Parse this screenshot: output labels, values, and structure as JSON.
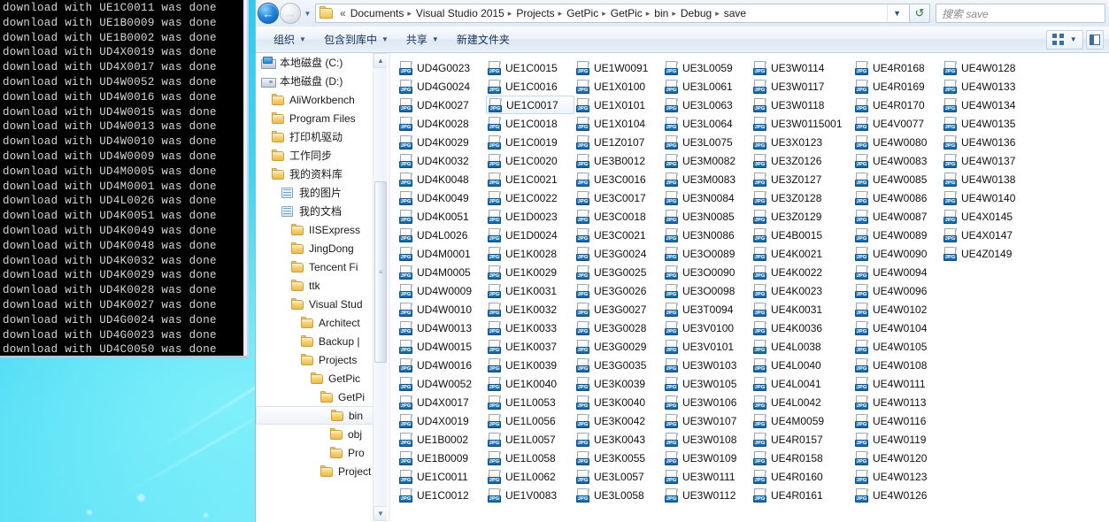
{
  "console": {
    "lines": [
      "download with UE1C0011 was done",
      "download with UE1B0009 was done",
      "download with UE1B0002 was done",
      "download with UD4X0019 was done",
      "download with UD4X0017 was done",
      "download with UD4W0052 was done",
      "download with UD4W0016 was done",
      "download with UD4W0015 was done",
      "download with UD4W0013 was done",
      "download with UD4W0010 was done",
      "download with UD4W0009 was done",
      "download with UD4M0005 was done",
      "download with UD4M0001 was done",
      "download with UD4L0026 was done",
      "download with UD4K0051 was done",
      "download with UD4K0049 was done",
      "download with UD4K0048 was done",
      "download with UD4K0032 was done",
      "download with UD4K0029 was done",
      "download with UD4K0028 was done",
      "download with UD4K0027 was done",
      "download with UD4G0024 was done",
      "download with UD4G0023 was done",
      "download with UD4C0050 was done"
    ]
  },
  "explorer": {
    "addressbar": {
      "back_glyph": "←",
      "forward_glyph": "→",
      "history_glyph": "▼",
      "overflow_glyph": "«",
      "dropdown_glyph": "▼",
      "refresh_glyph": "↺",
      "crumbs": [
        "Documents",
        "Visual Studio 2015",
        "Projects",
        "GetPic",
        "GetPic",
        "bin",
        "Debug",
        "save"
      ],
      "separator": "▸"
    },
    "search": {
      "placeholder": "搜索 save",
      "value": ""
    },
    "toolbar": {
      "items": [
        {
          "label": "组织",
          "has_caret": true
        },
        {
          "label": "包含到库中",
          "has_caret": true
        },
        {
          "label": "共享",
          "has_caret": true
        },
        {
          "label": "新建文件夹",
          "has_caret": false
        }
      ],
      "view_caret": "▼"
    },
    "nav_tree": {
      "scroll_up_glyph": "▲",
      "scroll_down_glyph": "▼",
      "thumb_grip": "≡",
      "items": [
        {
          "label": "本地磁盘 (C:)",
          "icon": "drive-c-icon",
          "indent": 0,
          "selected": false
        },
        {
          "label": "本地磁盘 (D:)",
          "icon": "drive-d-icon",
          "indent": 0,
          "selected": false
        },
        {
          "label": "AliWorkbench",
          "icon": "folder-icon",
          "indent": 1,
          "selected": false
        },
        {
          "label": "Program Files",
          "icon": "folder-icon",
          "indent": 1,
          "selected": false
        },
        {
          "label": "打印机驱动",
          "icon": "folder-icon",
          "indent": 1,
          "selected": false
        },
        {
          "label": "工作同步",
          "icon": "folder-icon",
          "indent": 1,
          "selected": false
        },
        {
          "label": "我的资料库",
          "icon": "folder-icon",
          "indent": 1,
          "selected": false
        },
        {
          "label": "我的图片",
          "icon": "library-icon",
          "indent": 2,
          "selected": false
        },
        {
          "label": "我的文档",
          "icon": "library-icon",
          "indent": 2,
          "selected": false
        },
        {
          "label": "IISExpress",
          "icon": "folder-icon",
          "indent": 3,
          "selected": false
        },
        {
          "label": "JingDong",
          "icon": "folder-icon",
          "indent": 3,
          "selected": false
        },
        {
          "label": "Tencent Fi",
          "icon": "folder-icon",
          "indent": 3,
          "selected": false
        },
        {
          "label": "ttk",
          "icon": "folder-icon",
          "indent": 3,
          "selected": false
        },
        {
          "label": "Visual Stud",
          "icon": "folder-icon",
          "indent": 3,
          "selected": false
        },
        {
          "label": "Architect",
          "icon": "folder-icon",
          "indent": 4,
          "selected": false
        },
        {
          "label": "Backup |",
          "icon": "folder-icon",
          "indent": 4,
          "selected": false
        },
        {
          "label": "Projects",
          "icon": "folder-icon",
          "indent": 4,
          "selected": false
        },
        {
          "label": "GetPic",
          "icon": "folder-icon",
          "indent": 5,
          "selected": false
        },
        {
          "label": "GetPi",
          "icon": "folder-icon",
          "indent": 6,
          "selected": false
        },
        {
          "label": "bin",
          "icon": "folder-icon",
          "indent": 7,
          "selected": true
        },
        {
          "label": "obj",
          "icon": "folder-icon",
          "indent": 7,
          "selected": false
        },
        {
          "label": "Pro",
          "icon": "folder-icon",
          "indent": 7,
          "selected": false
        },
        {
          "label": "Project",
          "icon": "folder-icon",
          "indent": 6,
          "selected": false
        }
      ]
    },
    "files": {
      "icon_label": "JPG",
      "selected": "UE1C0017",
      "names": [
        "UD4G0023",
        "UD4G0024",
        "UD4K0027",
        "UD4K0028",
        "UD4K0029",
        "UD4K0032",
        "UD4K0048",
        "UD4K0049",
        "UD4K0051",
        "UD4L0026",
        "UD4M0001",
        "UD4M0005",
        "UD4W0009",
        "UD4W0010",
        "UD4W0013",
        "UD4W0015",
        "UD4W0016",
        "UD4W0052",
        "UD4X0017",
        "UD4X0019",
        "UE1B0002",
        "UE1B0009",
        "UE1C0011",
        "UE1C0012",
        "UE1C0015",
        "UE1C0016",
        "UE1C0017",
        "UE1C0018",
        "UE1C0019",
        "UE1C0020",
        "UE1C0021",
        "UE1C0022",
        "UE1D0023",
        "UE1D0024",
        "UE1K0028",
        "UE1K0029",
        "UE1K0031",
        "UE1K0032",
        "UE1K0033",
        "UE1K0037",
        "UE1K0039",
        "UE1K0040",
        "UE1L0053",
        "UE1L0056",
        "UE1L0057",
        "UE1L0058",
        "UE1L0062",
        "UE1V0083",
        "UE1W0091",
        "UE1X0100",
        "UE1X0101",
        "UE1X0104",
        "UE1Z0107",
        "UE3B0012",
        "UE3C0016",
        "UE3C0017",
        "UE3C0018",
        "UE3C0021",
        "UE3G0024",
        "UE3G0025",
        "UE3G0026",
        "UE3G0027",
        "UE3G0028",
        "UE3G0029",
        "UE3G0035",
        "UE3K0039",
        "UE3K0040",
        "UE3K0042",
        "UE3K0043",
        "UE3K0055",
        "UE3L0057",
        "UE3L0058",
        "UE3L0059",
        "UE3L0061",
        "UE3L0063",
        "UE3L0064",
        "UE3L0075",
        "UE3M0082",
        "UE3M0083",
        "UE3N0084",
        "UE3N0085",
        "UE3N0086",
        "UE3O0089",
        "UE3O0090",
        "UE3O0098",
        "UE3T0094",
        "UE3V0100",
        "UE3V0101",
        "UE3W0103",
        "UE3W0105",
        "UE3W0106",
        "UE3W0107",
        "UE3W0108",
        "UE3W0109",
        "UE3W0111",
        "UE3W0112",
        "UE3W0114",
        "UE3W0117",
        "UE3W0118",
        "UE3W0115001",
        "UE3X0123",
        "UE3Z0126",
        "UE3Z0127",
        "UE3Z0128",
        "UE3Z0129",
        "UE4B0015",
        "UE4K0021",
        "UE4K0022",
        "UE4K0023",
        "UE4K0031",
        "UE4K0036",
        "UE4L0038",
        "UE4L0040",
        "UE4L0041",
        "UE4L0042",
        "UE4M0059",
        "UE4R0157",
        "UE4R0158",
        "UE4R0160",
        "UE4R0161",
        "UE4R0168",
        "UE4R0169",
        "UE4R0170",
        "UE4V0077",
        "UE4W0080",
        "UE4W0083",
        "UE4W0085",
        "UE4W0086",
        "UE4W0087",
        "UE4W0089",
        "UE4W0090",
        "UE4W0094",
        "UE4W0096",
        "UE4W0102",
        "UE4W0104",
        "UE4W0105",
        "UE4W0108",
        "UE4W0111",
        "UE4W0113",
        "UE4W0116",
        "UE4W0119",
        "UE4W0120",
        "UE4W0123",
        "UE4W0126",
        "UE4W0128",
        "UE4W0133",
        "UE4W0134",
        "UE4W0135",
        "UE4W0136",
        "UE4W0137",
        "UE4W0138",
        "UE4W0140",
        "UE4X0145",
        "UE4X0147",
        "UE4Z0149"
      ]
    }
  },
  "colors": {
    "accent": "#1565a8",
    "desktop": "#4fdcf4",
    "console_bg": "#000000",
    "console_text": "#d6d6d6"
  }
}
